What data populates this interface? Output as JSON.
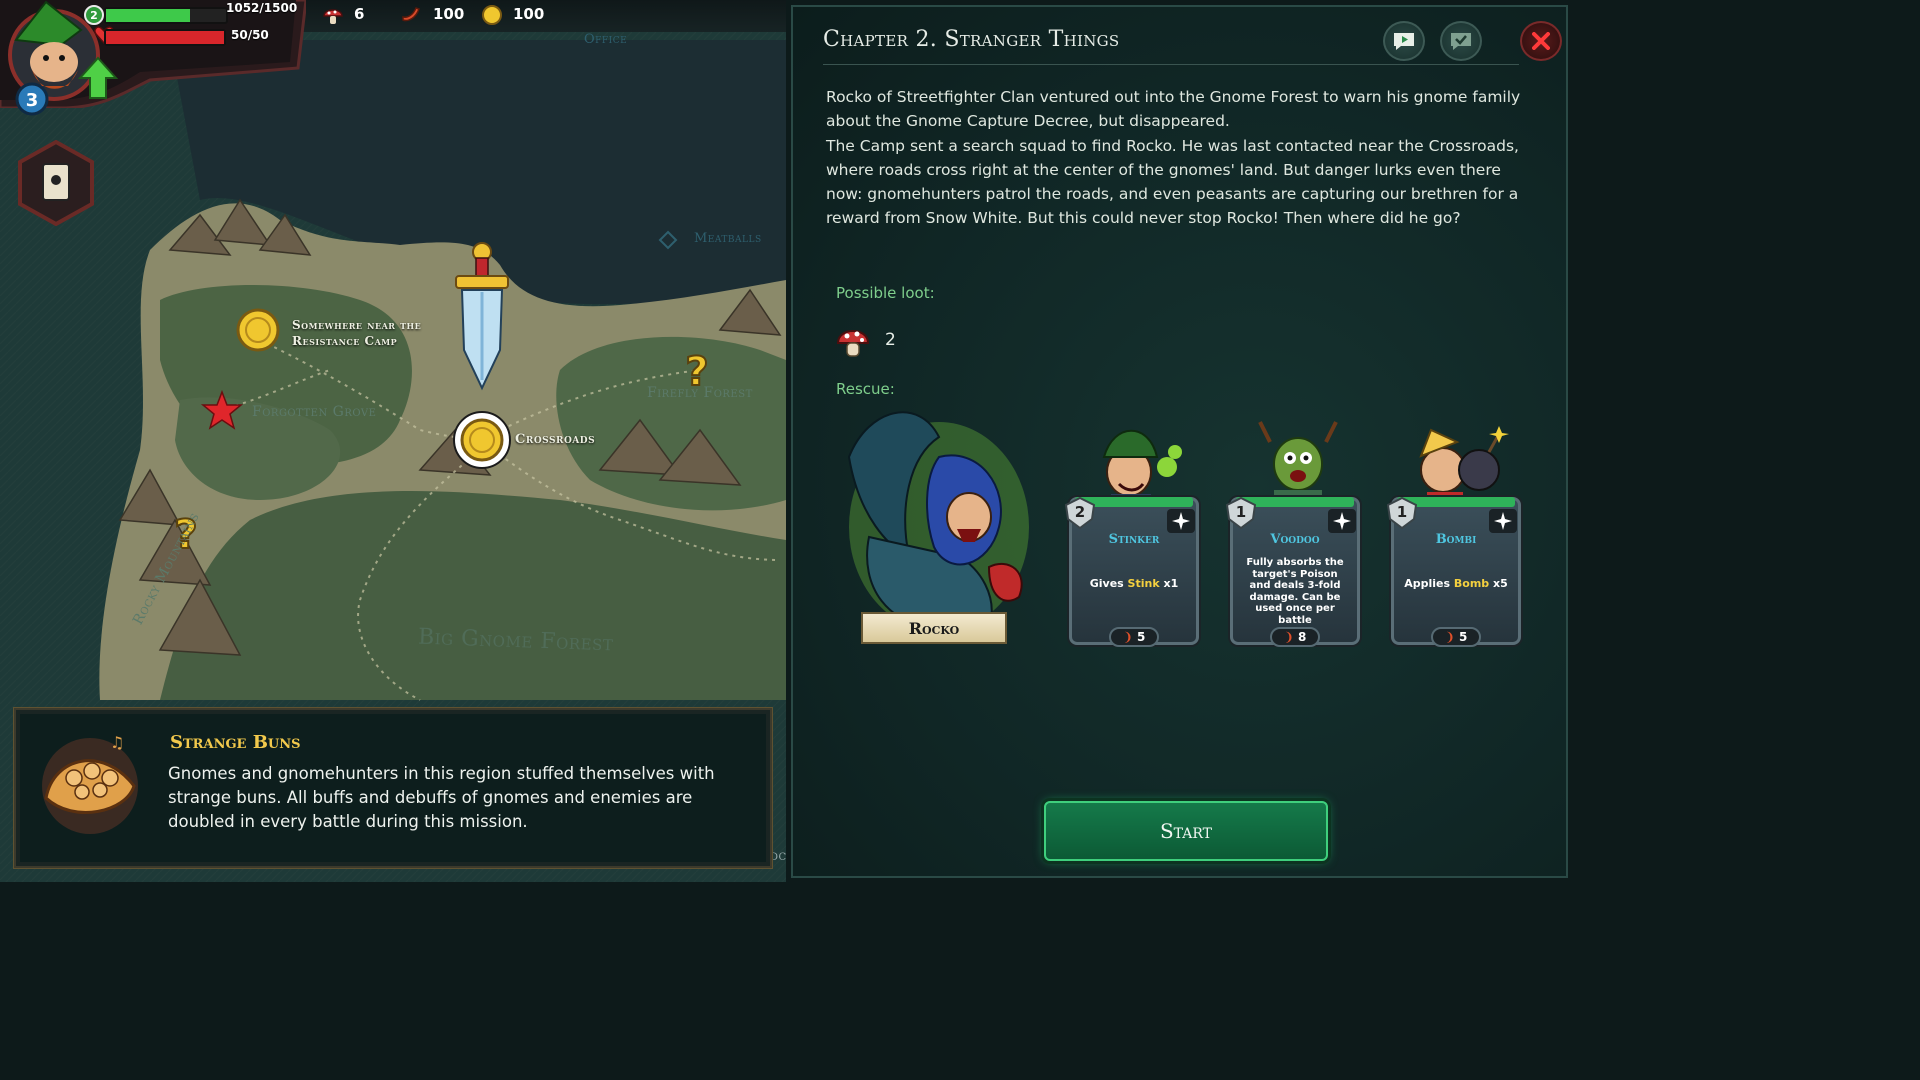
{
  "hud": {
    "player_level": "2",
    "xp_text": "1052/1500",
    "xp_fraction": 0.7,
    "hp_text": "50/50",
    "hp_fraction": 1.0,
    "cards_badge": "3",
    "resources": {
      "tokens": "6",
      "sausages": "100",
      "coins": "100"
    }
  },
  "map": {
    "labels": {
      "office": "Office",
      "meatballs": "Meatballs",
      "resistance_camp": "Somewhere near the Resistance Camp",
      "forgotten_grove": "Forgotten Grove",
      "crossroads": "Crossroads",
      "firefly_forest": "Firefly Forest",
      "big_gnome_forest": "Big Gnome Forest",
      "rocky_mountains": "Rocky Mountains",
      "edge_text": "DC"
    }
  },
  "mission": {
    "title": "Strange Buns",
    "description": "Gnomes and gnomehunters in this region stuffed themselves with strange buns. All buffs and debuffs of gnomes and enemies are doubled in every battle during this mission."
  },
  "panel": {
    "chapter_title": "Chapter 2. Stranger Things",
    "story_p1": "Rocko of Streetfighter Clan ventured out into the Gnome Forest to warn his gnome family about the Gnome Capture Decree, but disappeared.",
    "story_p2": "The Camp sent a search squad to find Rocko. He was last contacted near the Crossroads, where roads cross right at the center of the gnomes' land. But danger lurks even there now: gnomehunters patrol the roads, and even peasants are capturing our brethren for a reward from Snow White. But this could never stop Rocko! Then where did he go?",
    "loot_label": "Possible loot:",
    "loot_count": "2",
    "rescue_label": "Rescue:",
    "rescue_name": "Rocko",
    "start_label": "Start"
  },
  "cards": [
    {
      "name": "Stinker",
      "level": "2",
      "cost": "5",
      "desc_pre": "Gives ",
      "desc_hl": "Stink",
      "desc_post": " x1"
    },
    {
      "name": "Voodoo",
      "level": "1",
      "cost": "8",
      "desc_pre": "Fully absorbs the target's Poison and deals 3-fold damage. Can be used once per battle",
      "desc_hl": "",
      "desc_post": ""
    },
    {
      "name": "Bombi",
      "level": "1",
      "cost": "5",
      "desc_pre": "Applies ",
      "desc_hl": "Bomb",
      "desc_post": " x5"
    }
  ],
  "colors": {
    "accent_gold": "#f2c94c",
    "loot_green": "#7fcf8c",
    "card_name_blue": "#4fc6e0",
    "start_green": "#157a4a",
    "xp_green": "#3ec94a",
    "hp_red": "#d8262b"
  }
}
